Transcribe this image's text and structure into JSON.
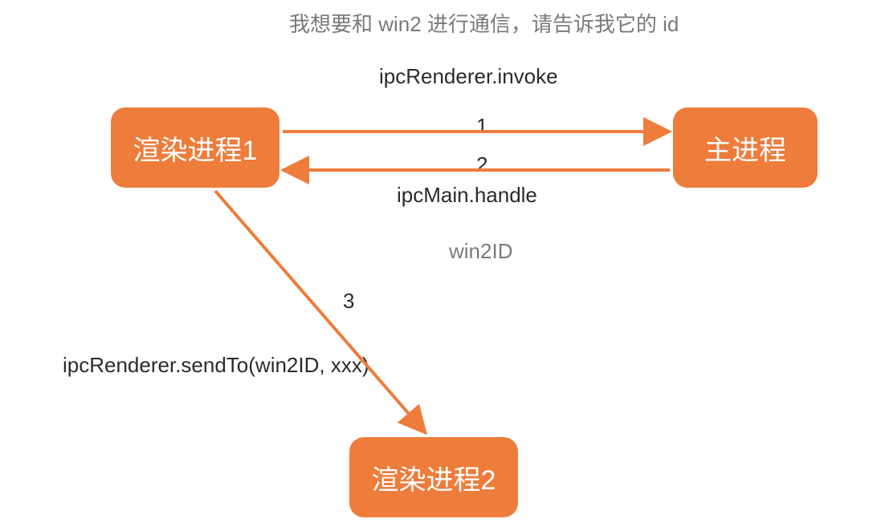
{
  "title": "我想要和 win2 进行通信，请告诉我它的 id",
  "nodes": {
    "renderer1": "渲染进程1",
    "main": "主进程",
    "renderer2": "渲染进程2"
  },
  "edges": {
    "e1": {
      "num": "1",
      "label": "ipcRenderer.invoke"
    },
    "e2": {
      "num": "2",
      "label": "ipcMain.handle"
    },
    "e3": {
      "num": "3",
      "label": "ipcRenderer.sendTo(win2ID, xxx)"
    }
  },
  "payload": "win2ID",
  "colors": {
    "node": "#ee7c3b",
    "arrow": "#ee7c3b",
    "text": "#2b2b2b",
    "muted": "#7a7a7a"
  }
}
